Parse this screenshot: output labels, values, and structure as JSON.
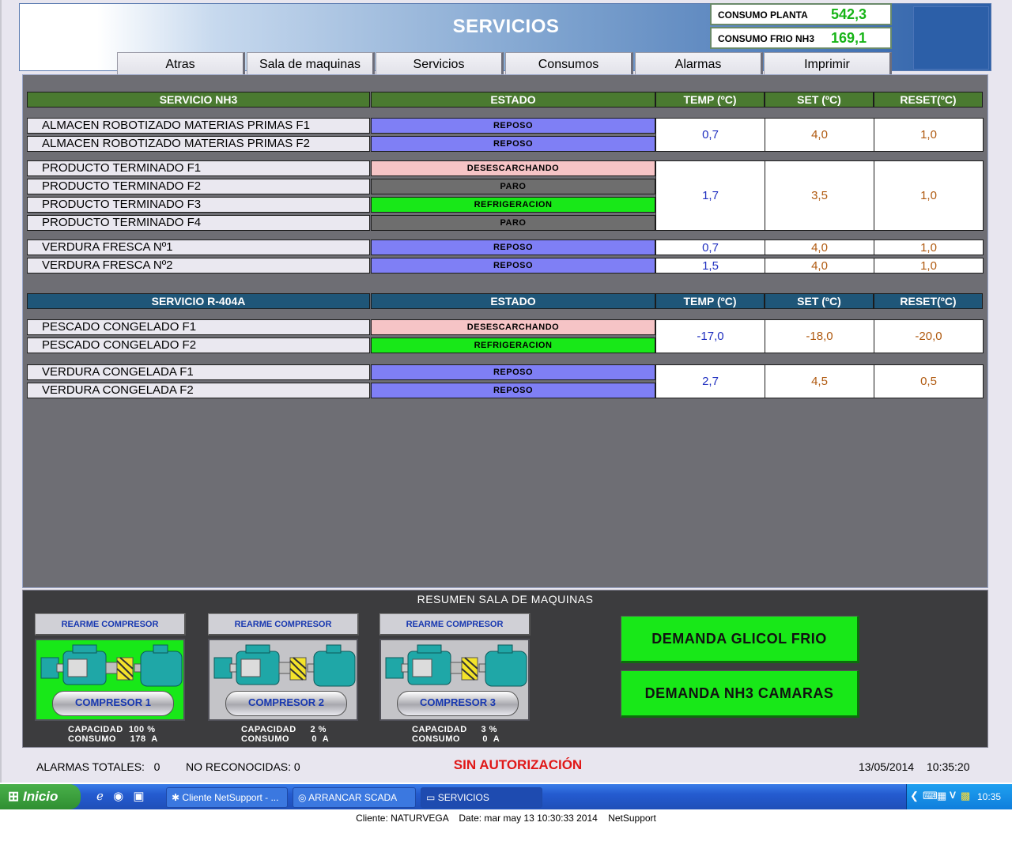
{
  "header": {
    "title": "SERVICIOS",
    "kpi": [
      {
        "label": "CONSUMO PLANTA",
        "value": "542,3"
      },
      {
        "label": "CONSUMO FRIO NH3",
        "value": "169,1"
      }
    ]
  },
  "nav": [
    "Atras",
    "Sala de maquinas",
    "Servicios",
    "Consumos",
    "Alarmas",
    "Imprimir"
  ],
  "nh3": {
    "headers": [
      "SERVICIO NH3",
      "ESTADO",
      "TEMP (ºC)",
      "SET (ºC)",
      "RESET(ºC)"
    ],
    "rows": [
      {
        "name": "ALMACEN ROBOTIZADO MATERIAS PRIMAS F1",
        "state": "REPOSO"
      },
      {
        "name": "ALMACEN ROBOTIZADO MATERIAS PRIMAS F2",
        "state": "REPOSO"
      },
      {
        "name": "PRODUCTO TERMINADO F1",
        "state": "DESESCARCHANDO"
      },
      {
        "name": "PRODUCTO TERMINADO F2",
        "state": "PARO"
      },
      {
        "name": "PRODUCTO TERMINADO F3",
        "state": "REFRIGERACION"
      },
      {
        "name": "PRODUCTO TERMINADO F4",
        "state": "PARO"
      },
      {
        "name": "VERDURA FRESCA Nº1",
        "state": "REPOSO"
      },
      {
        "name": "VERDURA FRESCA Nº2",
        "state": "REPOSO"
      }
    ],
    "groups": [
      {
        "temp": "0,7",
        "set": "4,0",
        "reset": "1,0"
      },
      {
        "temp": "1,7",
        "set": "3,5",
        "reset": "1,0"
      },
      {
        "temp": "0,7",
        "set": "4,0",
        "reset": "1,0"
      },
      {
        "temp": "1,5",
        "set": "4,0",
        "reset": "1,0"
      }
    ]
  },
  "r404a": {
    "headers": [
      "SERVICIO R-404A",
      "ESTADO",
      "TEMP (ºC)",
      "SET (ºC)",
      "RESET(ºC)"
    ],
    "rows": [
      {
        "name": "PESCADO CONGELADO F1",
        "state": "DESESCARCHANDO"
      },
      {
        "name": "PESCADO CONGELADO F2",
        "state": "REFRIGERACION"
      },
      {
        "name": "VERDURA CONGELADA F1",
        "state": "REPOSO"
      },
      {
        "name": "VERDURA CONGELADA F2",
        "state": "REPOSO"
      }
    ],
    "groups": [
      {
        "temp": "-17,0",
        "set": "-18,0",
        "reset": "-20,0"
      },
      {
        "temp": "2,7",
        "set": "4,5",
        "reset": "0,5"
      }
    ]
  },
  "resumen": {
    "title": "RESUMEN SALA DE MAQUINAS",
    "compressors": [
      {
        "rearme": "REARME COMPRESOR",
        "name": "COMPRESOR 1",
        "cap_label": "CAPACIDAD",
        "cap": "100 %",
        "cons_label": "CONSUMO",
        "cons": "178  A",
        "running": true
      },
      {
        "rearme": "REARME COMPRESOR",
        "name": "COMPRESOR 2",
        "cap_label": "CAPACIDAD",
        "cap": "2 %",
        "cons_label": "CONSUMO",
        "cons": "0  A",
        "running": false
      },
      {
        "rearme": "REARME COMPRESOR",
        "name": "COMPRESOR 3",
        "cap_label": "CAPACIDAD",
        "cap": "3 %",
        "cons_label": "CONSUMO",
        "cons": "0  A",
        "running": false
      }
    ],
    "demands": [
      "DEMANDA GLICOL FRIO",
      "DEMANDA NH3 CAMARAS"
    ]
  },
  "status": {
    "alarmas_label": "ALARMAS TOTALES:",
    "alarmas_value": "0",
    "noreco_label": "NO RECONOCIDAS:",
    "noreco_value": "0",
    "auth": "SIN AUTORIZACIÓN",
    "date": "13/05/2014",
    "time": "10:35:20"
  },
  "taskbar": {
    "start": "Inicio",
    "tasks": [
      "Cliente NetSupport - ...",
      "ARRANCAR SCADA",
      "SERVICIOS"
    ],
    "clock": "10:35"
  },
  "footer": {
    "client": "Cliente: NATURVEGA",
    "date": "Date: mar may 13 10:30:33 2014",
    "app": "NetSupport"
  },
  "colors": {
    "reposo": "#7f7ff5",
    "desescarchando": "#f6c4c6",
    "paro": "#6e6e6e",
    "refrigeracion": "#18e818",
    "nh3_header": "#4a7a30",
    "r404a_header": "#1f5678"
  }
}
